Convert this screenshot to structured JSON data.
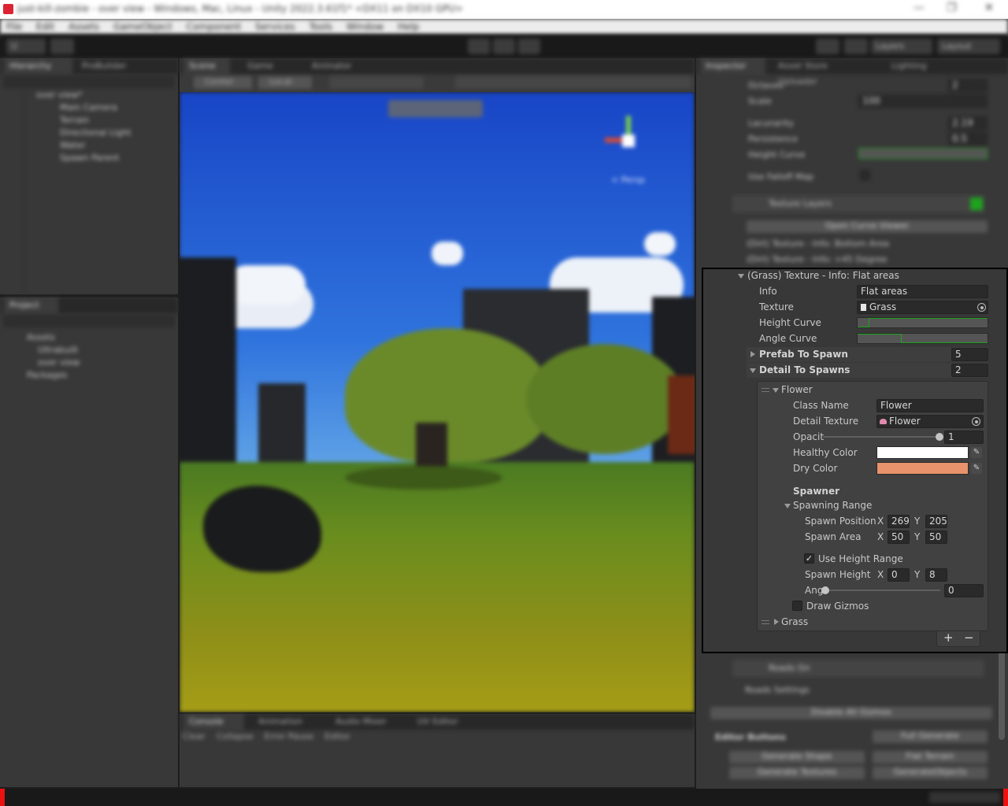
{
  "window": {
    "title": "just-kill-zombie - over view - Windows, Mac, Linux - Unity 2022.3.61f1* <DX11 on DX10 GPU>",
    "controls": [
      "—",
      "❐",
      "✕"
    ]
  },
  "menu": [
    "File",
    "Edit",
    "Assets",
    "GameObject",
    "Component",
    "Services",
    "Tools",
    "Window",
    "Help"
  ],
  "toolbar": {
    "account": "U",
    "layers_label": "Layers",
    "layout_label": "Layout"
  },
  "hierarchy": {
    "tabs": [
      "Hierarchy",
      "ProBuilder"
    ],
    "scene_name": "over view*",
    "items": [
      "Main Camera",
      "Terrain",
      "Directional Light",
      "Water",
      "Spawn Parent"
    ]
  },
  "project": {
    "tab": "Project",
    "items": [
      "Assets",
      "Ultrabuilt",
      "over view",
      "Packages"
    ]
  },
  "scene": {
    "tabs": [
      "Scene",
      "Game",
      "Animator"
    ],
    "toolbar": [
      "Center",
      "Local"
    ],
    "gizmo_label": "< Persp"
  },
  "console": {
    "tabs": [
      "Console",
      "Animation",
      "Audio Mixer",
      "UV Editor"
    ],
    "buttons": [
      "Clear",
      "Collapse",
      "Error Pause",
      "Editor"
    ]
  },
  "inspector": {
    "tabs": [
      "Inspector",
      "Asset Store Uploader",
      "Lighting"
    ],
    "above": {
      "rows": [
        {
          "label": "Octaves",
          "value": "2"
        },
        {
          "label": "Scale",
          "value": "100"
        },
        {
          "label": "Lacunarity",
          "value": "2.19"
        },
        {
          "label": "Persistence",
          "value": "0.5"
        },
        {
          "label": "Height Curve",
          "value": ""
        },
        {
          "label": "Use Falloff Map",
          "value": ""
        }
      ],
      "component": "Texture Layers",
      "button": "Open Curve Viewer",
      "collapsed": [
        "(Dirt) Texture - Info: Bottom Area",
        "(Dirt) Texture - Info: >45 Degree"
      ]
    },
    "grass_layer": {
      "header": "(Grass) Texture - Info: Flat areas",
      "info_label": "Info",
      "info_value": "Flat areas",
      "texture_label": "Texture",
      "texture_value": "Grass",
      "height_curve_label": "Height Curve",
      "angle_curve_label": "Angle Curve",
      "prefab_label": "Prefab To Spawn",
      "prefab_count": "5",
      "detail_label": "Detail To Spawns",
      "detail_count": "2",
      "flower": {
        "header": "Flower",
        "class_name_label": "Class Name",
        "class_name_value": "Flower",
        "detail_texture_label": "Detail Texture",
        "detail_texture_value": "Flower",
        "opacity_label": "Opacit",
        "opacity_value": "1",
        "opacity_fraction": 1.0,
        "healthy_color_label": "Healthy Color",
        "healthy_color": "#ffffff",
        "dry_color_label": "Dry Color",
        "dry_color": "#e8936b",
        "spawner_label": "Spawner",
        "spawning_range_label": "Spawning Range",
        "spawn_position_label": "Spawn Position",
        "spawn_position_x": "269",
        "spawn_position_y": "205",
        "spawn_area_label": "Spawn Area",
        "spawn_area_x": "50",
        "spawn_area_y": "50",
        "use_height_range_label": "Use Height Range",
        "use_height_range": true,
        "spawn_height_label": "Spawn Height",
        "spawn_height_x": "0",
        "spawn_height_y": "8",
        "angle_label": "Ang",
        "angle_value": "0",
        "angle_fraction": 0.0,
        "draw_gizmos_label": "Draw Gizmos",
        "draw_gizmos": false,
        "x_label": "X",
        "y_label": "Y"
      },
      "grass_item": "Grass",
      "add": "+",
      "remove": "−"
    },
    "below": {
      "component": "Roads Gn",
      "roads_settings": "Roads Settings",
      "button_disable": "Disable All Gizmos",
      "editor_buttons": "Editor Buttons",
      "full_generate": "Full Generate",
      "generate_shape": "Generate Shape",
      "flat_terrain": "Flat Terrain",
      "generate_textures": "Generate Textures",
      "generate_objects": "GenerateObjects"
    }
  },
  "colors": {
    "accent_green": "#1ea31e",
    "focus_border": "#000000"
  }
}
